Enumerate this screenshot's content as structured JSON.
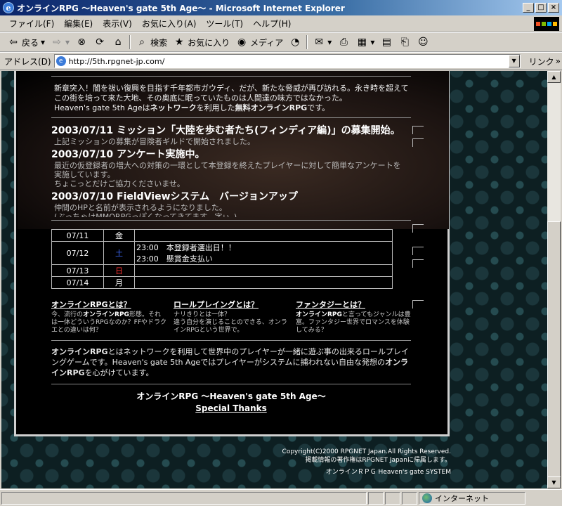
{
  "window": {
    "title": "オンラインRPG ～Heaven's gate 5th Age～ - Microsoft Internet Explorer",
    "buttons": [
      "_",
      "□",
      "×"
    ]
  },
  "menu": [
    "ファイル(F)",
    "編集(E)",
    "表示(V)",
    "お気に入り(A)",
    "ツール(T)",
    "ヘルプ(H)"
  ],
  "toolbar": {
    "back": "戻る",
    "search": "検索",
    "favorites": "お気に入り",
    "media": "メディア"
  },
  "address": {
    "label": "アドレス(D)",
    "url": "http://5th.rpgnet-jp.com/",
    "links": "リンク"
  },
  "page": {
    "intro_1": "新章突入！闇を祓い復興を目指す千年都市ガウディ、だが、新たな脅威が再び訪れる。永き時を超えてこの街を培って来た大地、その奥底に眠っていたものは人間達の味方ではなかった。",
    "intro_2": "Heaven's gate 5th Ageは",
    "intro_3": "ネットワーク",
    "intro_4": "を利用した",
    "intro_5": "無料オンラインRPG",
    "intro_6": "です。",
    "news": [
      {
        "head": "2003/07/11 ミッション「大陸を歩む者たち(フィンディア編)」の募集開始。",
        "body": "上記ミッションの募集が冒険者ギルドで開始されました。"
      },
      {
        "head": "2003/07/10 アンケート実施中。",
        "body": "最近の仮登録者の増大への対策の一環として本登録を終えたプレイヤーに対して簡単なアンケートを実施しています。",
        "body2": "ちょこっとだけご協力くださいませ。"
      },
      {
        "head": "2003/07/10 FieldViewシステム　バージョンアップ",
        "body": "仲間のHPと名前が表示されるようになりました。",
        "body2": "(ぶっちゃけMMORPGっぽくなってきてます、字ぃ。)"
      }
    ],
    "calendar": [
      {
        "date": "07/11",
        "dow": "金",
        "events": []
      },
      {
        "date": "07/12",
        "dow": "土",
        "events": [
          "23:00　本登録者選出日！！",
          "23:00　懸賞金支払い"
        ]
      },
      {
        "date": "07/13",
        "dow": "日",
        "events": []
      },
      {
        "date": "07/14",
        "dow": "月",
        "events": []
      }
    ],
    "about": [
      {
        "title": "オンラインRPGとは？",
        "t1": "今、流行の",
        "b1": "オンラインRPG",
        "t2": "形態。それは一体どういうRPGなのか？FFやドラクエとの違いは何？"
      },
      {
        "title": "ロールプレイングとは？",
        "t1": "ナリきりとは一体？",
        "b1": "",
        "t2": "違う自分を演じることのできる、オンラインRPGという世界で。"
      },
      {
        "title": "ファンタジーとは？",
        "t1": "",
        "b1": "オンラインRPG",
        "t2": "と言ってもジャンルは豊富。ファンタジー世界でロマンスを体験してみる？"
      }
    ],
    "outro_1": "オンラインRPG",
    "outro_2": "とはネットワークを利用して世界中のプレイヤーが一緒に遊ぶ事の出来るロールプレイングゲームです。Heaven's gate 5th Ageではプレイヤーがシステムに捕われない自由な発想の",
    "outro_3": "オンラインRPG",
    "outro_4": "を心がけています。",
    "footer_title": "オンラインRPG ～Heaven's gate 5th Age～",
    "footer_link": "Special Thanks",
    "copyright_1": "Copyright(C)2000 RPGNET Japan.All Rights Reserved.",
    "copyright_2": "掲載情報の著作権はRPGNET Japanに帰属します。",
    "system": "オンラインＲＰＧ Heaven's gate SYSTEM"
  },
  "status": {
    "zone": "インターネット"
  },
  "colors": {
    "titlebar": "#0a246a",
    "page_bg": "#000000",
    "saturday": "#3f6cff",
    "sunday": "#ff3030"
  }
}
